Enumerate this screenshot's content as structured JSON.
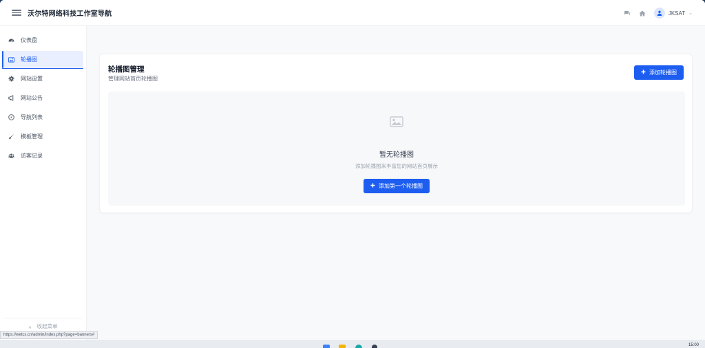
{
  "header": {
    "title": "沃尔特网络科技工作室导航",
    "username": "JKSAT",
    "icons": [
      "menu-icon",
      "chat-icon",
      "home-icon",
      "user-icon",
      "chevron-down-icon"
    ]
  },
  "sidebar": {
    "items": [
      {
        "label": "仪表盘",
        "icon": "dashboard-icon"
      },
      {
        "label": "轮播图",
        "icon": "image-icon",
        "active": true
      },
      {
        "label": "网站设置",
        "icon": "gear-icon"
      },
      {
        "label": "网站公告",
        "icon": "megaphone-icon"
      },
      {
        "label": "导航列表",
        "icon": "compass-icon"
      },
      {
        "label": "模板管理",
        "icon": "brush-icon"
      },
      {
        "label": "访客记录",
        "icon": "users-icon"
      }
    ],
    "collapse_label": "收起菜单"
  },
  "main": {
    "title": "轮播图管理",
    "subtitle": "管理网站首页轮播图",
    "add_button": "添加轮播图",
    "empty": {
      "title": "暂无轮播图",
      "description": "添加轮播图来丰富您的网站首页展示",
      "button": "添加第一个轮播图"
    }
  },
  "status_bar": {
    "url": "https://wetcs.cn/admin/index.php?page=banners#"
  },
  "taskbar": {
    "time": "15:00"
  },
  "colors": {
    "accent": "#1d5ef0",
    "active_bg": "#e9efff",
    "page_bg": "#f8f9fb"
  }
}
